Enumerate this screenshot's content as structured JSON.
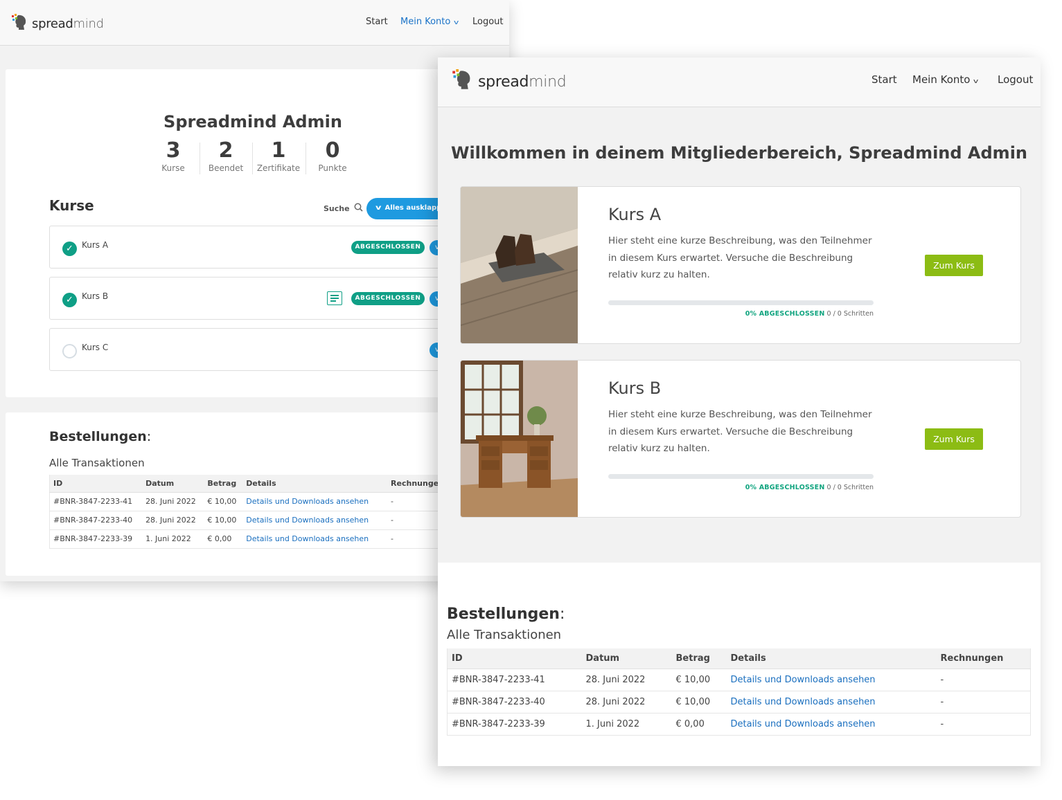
{
  "brand": {
    "logo_bold": "spread",
    "logo_light": "mind"
  },
  "back_window": {
    "nav": {
      "start": "Start",
      "account": "Mein Konto",
      "logout": "Logout"
    },
    "admin_name": "Spreadmind Admin",
    "stats": [
      {
        "value": "3",
        "label": "Kurse"
      },
      {
        "value": "2",
        "label": "Beendet"
      },
      {
        "value": "1",
        "label": "Zertifikate"
      },
      {
        "value": "0",
        "label": "Punkte"
      }
    ],
    "courses_heading": "Kurse",
    "search_label": "Suche",
    "expand_all": "Alles ausklappen",
    "courses": [
      {
        "name": "Kurs A",
        "status": "ABGESCHLOSSEN"
      },
      {
        "name": "Kurs B",
        "status": "ABGESCHLOSSEN"
      },
      {
        "name": "Kurs C",
        "status": ""
      }
    ],
    "orders": {
      "heading": "Bestellungen",
      "colon": ":",
      "subheading": "Alle Transaktionen",
      "columns": [
        "ID",
        "Datum",
        "Betrag",
        "Details",
        "Rechnungen"
      ],
      "rows": [
        [
          "#BNR-3847-2233-41",
          "28. Juni 2022",
          "€ 10,00",
          "Details und Downloads ansehen",
          "-"
        ],
        [
          "#BNR-3847-2233-40",
          "28. Juni 2022",
          "€ 10,00",
          "Details und Downloads ansehen",
          "-"
        ],
        [
          "#BNR-3847-2233-39",
          "1. Juni 2022",
          "€ 0,00",
          "Details und Downloads ansehen",
          "-"
        ]
      ]
    }
  },
  "front_window": {
    "nav": {
      "start": "Start",
      "account": "Mein Konto",
      "logout": "Logout"
    },
    "welcome": "Willkommen in deinem Mitgliederbereich, Spreadmind Admin",
    "courses": [
      {
        "title": "Kurs A",
        "description": "Hier steht eine kurze Beschreibung, was den Teilnehmer in diesem Kurs erwartet. Versuche die Beschreibung relativ kurz zu halten.",
        "progress_percent": 0,
        "progress_label": "0% ABGESCHLOSSEN",
        "steps": "0 / 0 Schritten",
        "button": "Zum Kurs"
      },
      {
        "title": "Kurs B",
        "description": "Hier steht eine kurze Beschreibung, was den Teilnehmer in diesem Kurs erwartet. Versuche die Beschreibung relativ kurz zu halten.",
        "progress_percent": 0,
        "progress_label": "0% ABGESCHLOSSEN",
        "steps": "0 / 0 Schritten",
        "button": "Zum Kurs"
      }
    ],
    "orders": {
      "heading": "Bestellungen",
      "colon": ":",
      "subheading": "Alle Transaktionen",
      "columns": [
        "ID",
        "Datum",
        "Betrag",
        "Details",
        "Rechnungen"
      ],
      "rows": [
        [
          "#BNR-3847-2233-41",
          "28. Juni 2022",
          "€ 10,00",
          "Details und Downloads ansehen",
          "-"
        ],
        [
          "#BNR-3847-2233-40",
          "28. Juni 2022",
          "€ 10,00",
          "Details und Downloads ansehen",
          "-"
        ],
        [
          "#BNR-3847-2233-39",
          "1. Juni 2022",
          "€ 0,00",
          "Details und Downloads ansehen",
          "-"
        ]
      ]
    }
  },
  "colors": {
    "accent_blue": "#1a73c8",
    "success_green": "#0f9f86",
    "button_green": "#8cbc14"
  }
}
